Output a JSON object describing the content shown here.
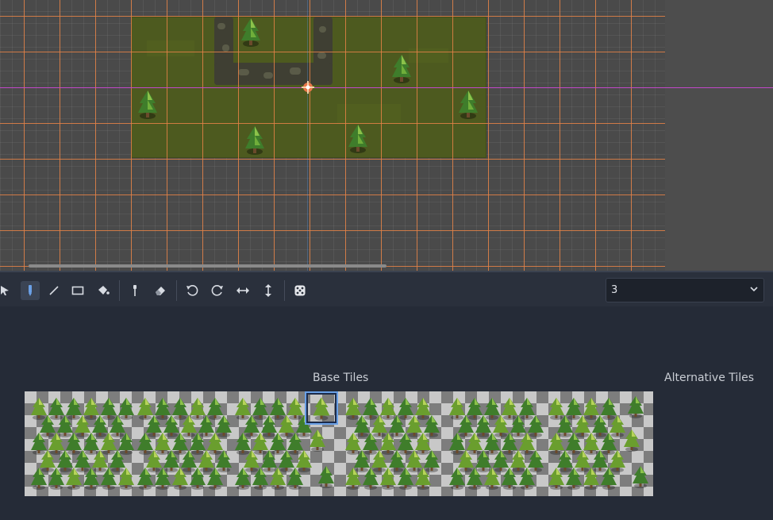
{
  "toolbar": {
    "tools": [
      {
        "name": "select-tool",
        "icon": "select-arrow-icon"
      },
      {
        "name": "paint-tool",
        "icon": "pencil-icon",
        "active": true
      },
      {
        "name": "line-tool",
        "icon": "line-icon"
      },
      {
        "name": "rect-tool",
        "icon": "rectangle-icon"
      },
      {
        "name": "bucket-tool",
        "icon": "bucket-icon"
      },
      {
        "name": "picker-tool",
        "icon": "eyedropper-icon"
      },
      {
        "name": "eraser-tool",
        "icon": "eraser-icon"
      },
      {
        "name": "rotate-left",
        "icon": "rotate-left-icon"
      },
      {
        "name": "rotate-right",
        "icon": "rotate-right-icon"
      },
      {
        "name": "flip-h",
        "icon": "flip-horizontal-icon"
      },
      {
        "name": "flip-v",
        "icon": "flip-vertical-icon"
      },
      {
        "name": "random-tile",
        "icon": "dice-icon"
      }
    ],
    "layer_value": "3"
  },
  "tileset": {
    "base_tiles_label": "Base Tiles",
    "alternative_tiles_label": "Alternative Tiles"
  },
  "colors": {
    "accent": "#6aa0e6",
    "grid_line": "#e6824a",
    "grass": "#4d5a1f",
    "axis_x": "#c247c9"
  }
}
